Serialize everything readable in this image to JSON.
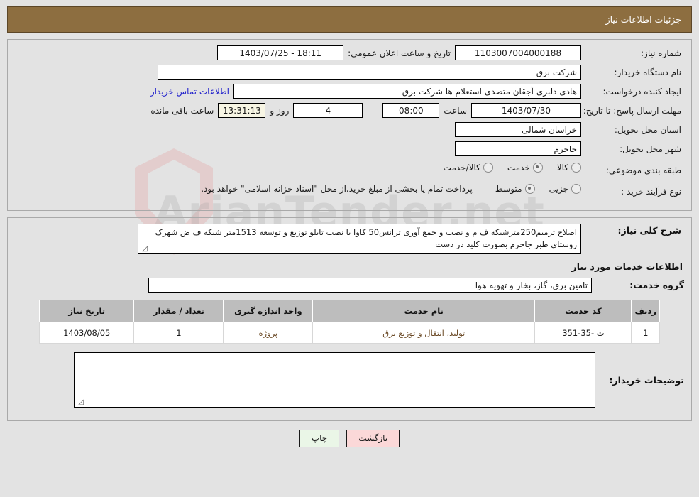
{
  "header": {
    "title": "جزئیات اطلاعات نیاز"
  },
  "form": {
    "need_number_label": "شماره نیاز:",
    "need_number_value": "1103007004000188",
    "public_announce_label": "تاریخ و ساعت اعلان عمومی:",
    "public_announce_value": "1403/07/25 - 18:11",
    "buyer_org_label": "نام دستگاه خریدار:",
    "buyer_org_value": "شرکت برق",
    "creator_label": "ایجاد کننده درخواست:",
    "creator_value": "هادی دلبری آجقان متصدی استعلام ها  شرکت برق",
    "contact_link": "اطلاعات تماس خریدار",
    "deadline_label": "مهلت ارسال پاسخ: تا تاریخ:",
    "deadline_date": "1403/07/30",
    "deadline_hour_label": "ساعت",
    "deadline_time": "08:00",
    "remaining_days": "4",
    "days_and_label": "روز و",
    "remaining_clock": "13:31:13",
    "remaining_suffix": "ساعت باقی مانده",
    "province_label": "استان محل تحویل:",
    "province_value": "خراسان شمالی",
    "city_label": "شهر محل تحویل:",
    "city_value": "جاجرم",
    "category_label": "طبقه بندی موضوعی:",
    "category_options": [
      {
        "label": "کالا",
        "checked": false
      },
      {
        "label": "خدمت",
        "checked": true
      },
      {
        "label": "کالا/خدمت",
        "checked": false
      }
    ],
    "process_label": "نوع فرآیند خرید :",
    "process_options": [
      {
        "label": "جزیی",
        "checked": false
      },
      {
        "label": "متوسط",
        "checked": true
      }
    ],
    "process_note": "پرداخت تمام یا بخشی از مبلغ خرید،از محل \"اسناد خزانه اسلامی\" خواهد بود."
  },
  "description": {
    "label": "شرح کلی نیاز:",
    "value": "اصلاح ترمیم250مترشبکه ف م و نصب و جمع آوری ترانس50 کاوا با نصب تابلو توزیع و توسعه 1513متر شبکه ف ض شهرک روستای طبر جاجرم بصورت کلید در دست"
  },
  "services_section": {
    "title": "اطلاعات خدمات مورد نیاز",
    "group_label": "گروه خدمت:",
    "group_value": "تامین برق، گاز، بخار و تهویه هوا"
  },
  "table": {
    "columns": [
      "ردیف",
      "کد خدمت",
      "نام خدمت",
      "واحد اندازه گیری",
      "تعداد / مقدار",
      "تاریخ نیاز"
    ],
    "rows": [
      {
        "radif": "1",
        "code": "ت -35-351",
        "name": "تولید، انتقال و توزیع برق",
        "unit": "پروژه",
        "qty": "1",
        "date": "1403/08/05"
      }
    ]
  },
  "buyer_notes": {
    "label": "توضیحات خریدار:",
    "value": ""
  },
  "buttons": {
    "print": "چاپ",
    "back": "بازگشت"
  },
  "watermark": {
    "text": "ArianTender.net"
  },
  "colors": {
    "header_bg": "#8d6e40",
    "page_bg": "#e3e3e3",
    "table_header_bg": "#bdbdbd",
    "link": "#2222cc",
    "btn_print_bg": "#eaf6e7",
    "btn_back_bg": "#fbd8d8",
    "highlight_field_bg": "#f7f5e4",
    "table_cell_text": "#6b4a26"
  }
}
